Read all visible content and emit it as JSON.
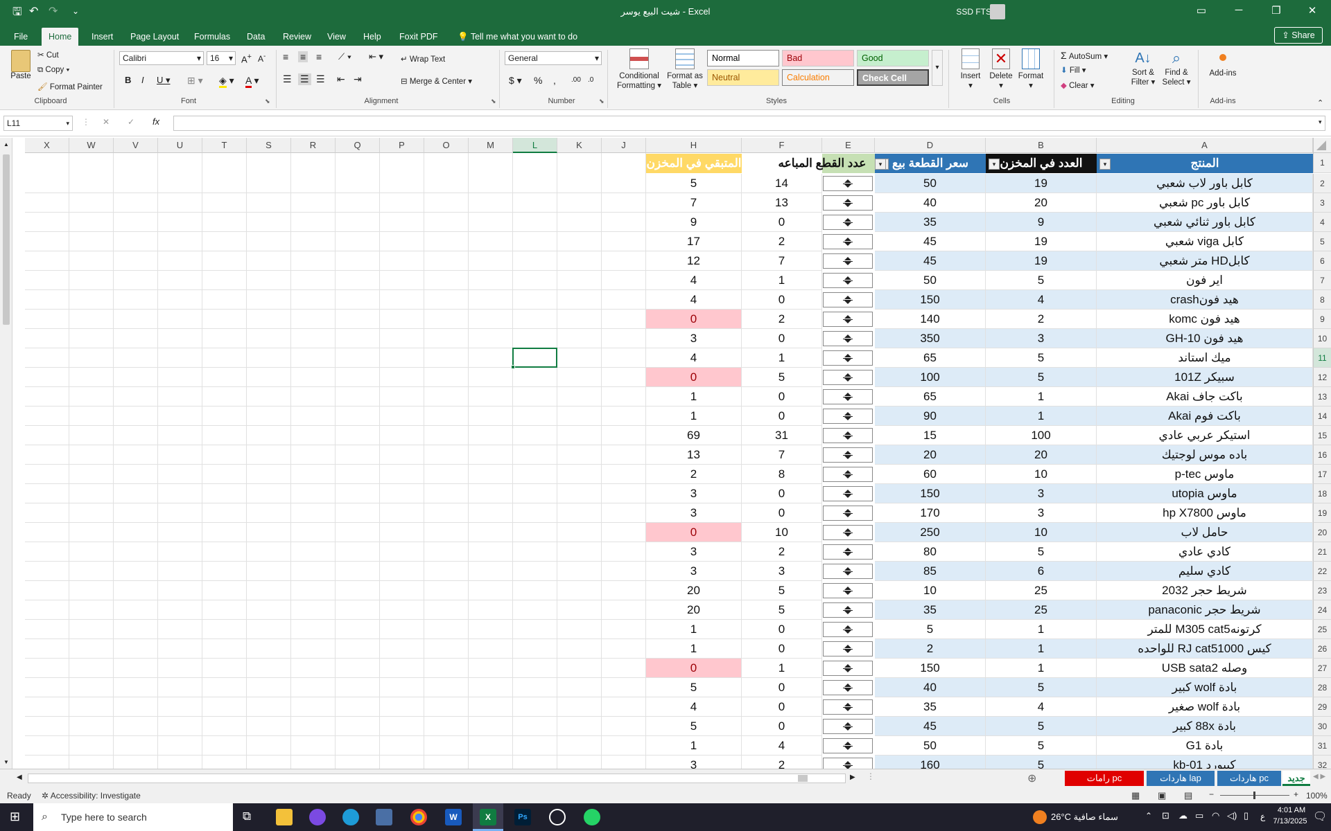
{
  "window": {
    "title": "شيت البيع يوسر  -  Excel",
    "user": "SSD FTS"
  },
  "tabs": [
    "File",
    "Home",
    "Insert",
    "Page Layout",
    "Formulas",
    "Data",
    "Review",
    "View",
    "Help",
    "Foxit PDF"
  ],
  "tell_me": "Tell me what you want to do",
  "share": "Share",
  "ribbon": {
    "clipboard": {
      "paste": "Paste",
      "cut": "Cut",
      "copy": "Copy",
      "format_painter": "Format Painter",
      "label": "Clipboard"
    },
    "font": {
      "name": "Calibri",
      "size": "16",
      "label": "Font"
    },
    "alignment": {
      "wrap": "Wrap Text",
      "merge": "Merge & Center",
      "label": "Alignment"
    },
    "number": {
      "format": "General",
      "label": "Number"
    },
    "styles": {
      "conditional": "Conditional Formatting",
      "format_table": "Format as Table",
      "normal": "Normal",
      "bad": "Bad",
      "good": "Good",
      "neutral": "Neutral",
      "calculation": "Calculation",
      "check": "Check Cell",
      "label": "Styles"
    },
    "cells": {
      "insert": "Insert",
      "delete": "Delete",
      "format": "Format",
      "label": "Cells"
    },
    "editing": {
      "autosum": "AutoSum",
      "fill": "Fill",
      "clear": "Clear",
      "sort": "Sort & Filter",
      "find": "Find & Select",
      "label": "Editing"
    },
    "addins": {
      "addins": "Add-ins",
      "label": "Add-ins"
    }
  },
  "namebox": "L11",
  "columns": [
    "A",
    "B",
    "D",
    "E",
    "F",
    "H",
    "J",
    "K",
    "L",
    "M",
    "O",
    "P",
    "Q",
    "R",
    "S",
    "T",
    "U",
    "V",
    "W",
    "X"
  ],
  "headers": {
    "a": "المنتج",
    "b": "العدد في المخزن",
    "d": "سعر القطعة بيع",
    "f": "عدد القطع المباعه",
    "h": "المتبقي في المخزن"
  },
  "rows": [
    {
      "n": "2",
      "a": "كابل باور لاب شعبي",
      "b": "19",
      "d": "50",
      "f": "14",
      "h": "5"
    },
    {
      "n": "3",
      "a": "كابل باور pc شعبي",
      "b": "20",
      "d": "40",
      "f": "13",
      "h": "7"
    },
    {
      "n": "4",
      "a": "كابل باور ثنائي شعبي",
      "b": "9",
      "d": "35",
      "f": "0",
      "h": "9"
    },
    {
      "n": "5",
      "a": "كابل viga شعبي",
      "b": "19",
      "d": "45",
      "f": "2",
      "h": "17"
    },
    {
      "n": "6",
      "a": "كابلHD متر شعبي",
      "b": "19",
      "d": "45",
      "f": "7",
      "h": "12"
    },
    {
      "n": "7",
      "a": "اير فون",
      "b": "5",
      "d": "50",
      "f": "1",
      "h": "4"
    },
    {
      "n": "8",
      "a": "هيد فونcrash",
      "b": "4",
      "d": "150",
      "f": "0",
      "h": "4"
    },
    {
      "n": "9",
      "a": "هيد فون komc",
      "b": "2",
      "d": "140",
      "f": "2",
      "h": "0"
    },
    {
      "n": "10",
      "a": "هيد فون GH-10",
      "b": "3",
      "d": "350",
      "f": "0",
      "h": "3"
    },
    {
      "n": "11",
      "a": "ميك استاند",
      "b": "5",
      "d": "65",
      "f": "1",
      "h": "4"
    },
    {
      "n": "12",
      "a": "سبيكر 101Z",
      "b": "5",
      "d": "100",
      "f": "5",
      "h": "0"
    },
    {
      "n": "13",
      "a": "باكت جاف Akai",
      "b": "1",
      "d": "65",
      "f": "0",
      "h": "1"
    },
    {
      "n": "14",
      "a": "باكت فوم Akai",
      "b": "1",
      "d": "90",
      "f": "0",
      "h": "1"
    },
    {
      "n": "15",
      "a": "استيكر عربي عادي",
      "b": "100",
      "d": "15",
      "f": "31",
      "h": "69"
    },
    {
      "n": "16",
      "a": "باده موس لوجتيك",
      "b": "20",
      "d": "20",
      "f": "7",
      "h": "13"
    },
    {
      "n": "17",
      "a": "ماوس p-tec",
      "b": "10",
      "d": "60",
      "f": "8",
      "h": "2"
    },
    {
      "n": "18",
      "a": "ماوس utopia",
      "b": "3",
      "d": "150",
      "f": "0",
      "h": "3"
    },
    {
      "n": "19",
      "a": "ماوس hp X7800",
      "b": "3",
      "d": "170",
      "f": "0",
      "h": "3"
    },
    {
      "n": "20",
      "a": "حامل لاب",
      "b": "10",
      "d": "250",
      "f": "10",
      "h": "0"
    },
    {
      "n": "21",
      "a": "كادي عادي",
      "b": "5",
      "d": "80",
      "f": "2",
      "h": "3"
    },
    {
      "n": "22",
      "a": "كادي سليم",
      "b": "6",
      "d": "85",
      "f": "3",
      "h": "3"
    },
    {
      "n": "23",
      "a": "شريط حجر 2032",
      "b": "25",
      "d": "10",
      "f": "5",
      "h": "20"
    },
    {
      "n": "24",
      "a": "شريط حجر panaconic",
      "b": "25",
      "d": "35",
      "f": "5",
      "h": "20"
    },
    {
      "n": "25",
      "a": "كرتونهM305 cat5 للمتر",
      "b": "1",
      "d": "5",
      "f": "0",
      "h": "1"
    },
    {
      "n": "26",
      "a": "كيس RJ cat51000 للواحده",
      "b": "1",
      "d": "2",
      "f": "0",
      "h": "1"
    },
    {
      "n": "27",
      "a": "وصله USB sata2",
      "b": "1",
      "d": "150",
      "f": "1",
      "h": "0"
    },
    {
      "n": "28",
      "a": "بادة wolf كبير",
      "b": "5",
      "d": "40",
      "f": "0",
      "h": "5"
    },
    {
      "n": "29",
      "a": "بادة wolf صغير",
      "b": "4",
      "d": "35",
      "f": "0",
      "h": "4"
    },
    {
      "n": "30",
      "a": "بادة 88x كبير",
      "b": "5",
      "d": "45",
      "f": "0",
      "h": "5"
    },
    {
      "n": "31",
      "a": "بادة G1",
      "b": "5",
      "d": "50",
      "f": "4",
      "h": "1"
    },
    {
      "n": "32",
      "a": "كيبورد kb-01",
      "b": "5",
      "d": "160",
      "f": "2",
      "h": "3"
    }
  ],
  "sheet_tabs": [
    "جديد",
    "هاردات pc",
    "هاردات lap",
    "رامات pc"
  ],
  "status": {
    "ready": "Ready",
    "accessibility": "Accessibility: Investigate",
    "zoom": "100%"
  },
  "taskbar": {
    "search": "Type here to search",
    "weather": "26°C  سماء صافية",
    "time": "4:01 AM",
    "date": "7/13/2025",
    "lang": "ع"
  },
  "colors": {
    "excel_green": "#1d6b3c",
    "header_blue": "#2f75b5",
    "header_dark": "#111111",
    "header_green": "#c6e0b4",
    "header_yellow": "#ffd966",
    "zero_red": "#ffc7ce",
    "band_blue": "#ddebf7"
  }
}
